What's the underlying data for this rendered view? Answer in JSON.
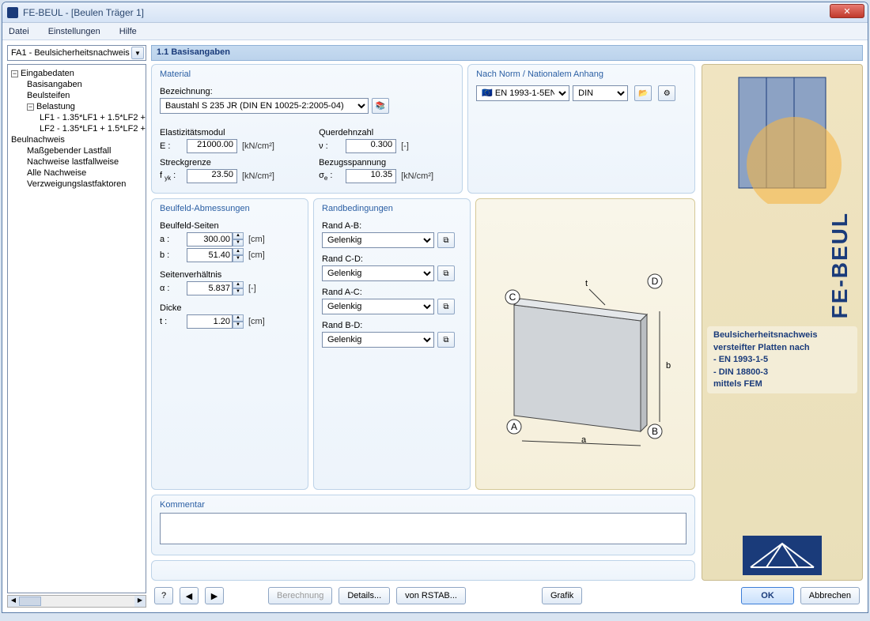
{
  "window": {
    "title": "FE-BEUL - [Beulen Träger 1]"
  },
  "menu": {
    "file": "Datei",
    "settings": "Einstellungen",
    "help": "Hilfe"
  },
  "case_selector": "FA1 - Beulsicherheitsnachweis",
  "tree": {
    "root1": "Eingabedaten",
    "n1": "Basisangaben",
    "n2": "Beulsteifen",
    "n3": "Belastung",
    "n3a": "LF1 - 1.35*LF1 + 1.5*LF2 +",
    "n3b": "LF2 - 1.35*LF1 + 1.5*LF2 +",
    "root2": "Beulnachweis",
    "m1": "Maßgebender Lastfall",
    "m2": "Nachweise lastfallweise",
    "m3": "Alle Nachweise",
    "m4": "Verzweigungslastfaktoren"
  },
  "header": "1.1 Basisangaben",
  "material": {
    "hdr": "Material",
    "bez_label": "Bezeichnung:",
    "bez_value": "Baustahl S 235 JR (DIN EN 10025-2:2005-04)",
    "emod_label": "Elastizitätsmodul",
    "emod_sym": "E :",
    "emod_val": "21000.00",
    "emod_unit": "[kN/cm²]",
    "quer_label": "Querdehnzahl",
    "quer_sym": "ν :",
    "quer_val": "0.300",
    "quer_unit": "[-]",
    "streck_label": "Streckgrenze",
    "streck_sym": "f yk :",
    "streck_val": "23.50",
    "streck_unit": "[kN/cm²]",
    "bezug_label": "Bezugsspannung",
    "bezug_sym": "σe :",
    "bezug_val": "10.35",
    "bezug_unit": "[kN/cm²]"
  },
  "norm": {
    "hdr": "Nach Norm / Nationalem Anhang",
    "code": "EN 1993-1-5",
    "annex": "DIN"
  },
  "dim": {
    "hdr": "Beulfeld-Abmessungen",
    "sides": "Beulfeld-Seiten",
    "a_sym": "a :",
    "a_val": "300.00",
    "a_unit": "[cm]",
    "b_sym": "b :",
    "b_val": "51.40",
    "b_unit": "[cm]",
    "ratio": "Seitenverhältnis",
    "alpha_sym": "α :",
    "alpha_val": "5.837",
    "alpha_unit": "[-]",
    "thick": "Dicke",
    "t_sym": "t :",
    "t_val": "1.20",
    "t_unit": "[cm]"
  },
  "rand": {
    "hdr": "Randbedingungen",
    "ab": "Rand A-B:",
    "cd": "Rand C-D:",
    "ac": "Rand A-C:",
    "bd": "Rand B-D:",
    "val": "Gelenkig"
  },
  "comment": {
    "hdr": "Kommentar",
    "text": ""
  },
  "right": {
    "title": "FE-BEUL",
    "desc1": "Beulsicherheitsnachweis",
    "desc2": "versteifter Platten nach",
    "desc3": "- EN 1993-1-5",
    "desc4": "- DIN 18800-3",
    "desc5": "mittels FEM"
  },
  "footer": {
    "calc": "Berechnung",
    "details": "Details...",
    "rstab": "von RSTAB...",
    "grafik": "Grafik",
    "ok": "OK",
    "cancel": "Abbrechen"
  }
}
